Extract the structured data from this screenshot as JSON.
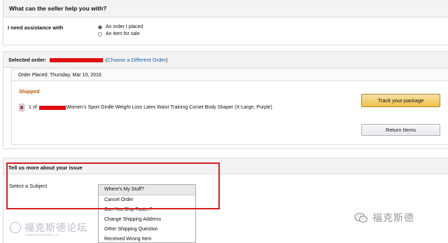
{
  "help_panel": {
    "title": "What can the seller help you with?",
    "assist_label": "I need assistance with",
    "options": [
      {
        "label": "An order I placed",
        "selected": true
      },
      {
        "label": "An item for sale",
        "selected": false
      }
    ]
  },
  "order_panel": {
    "selected_label": "Selected order:",
    "change_link": "Choose a Different Order",
    "placed": "Order Placed: Thursday, Mar 10, 2016",
    "status": "Shipped",
    "item_qty": "1 of",
    "item_title": "Women's Sport Girdle Weight Loss Latex Waist Training Corset Body Shaper (X-Large, Purple)",
    "track_button": "Track your package",
    "return_button": "Return Items"
  },
  "issue_panel": {
    "title": "Tell us more about your issue",
    "subject_label": "Select a Subject",
    "subjects": [
      "Where's My Stuff?",
      "Cancel Order",
      "Can You Ship Faster?",
      "Change Shipping Address",
      "Other Shipping Question",
      "Received Wrong Item"
    ],
    "selected_subject_index": 0
  },
  "watermarks": {
    "left_text": "福克斯德论坛",
    "left_sub": "www.amazonfox.cn",
    "right_text": "福克斯德"
  },
  "colors": {
    "status_orange": "#c45500",
    "link_blue": "#1a5ea8",
    "highlight_red": "#d81e1e",
    "redaction_red": "#e01010",
    "track_button_yellow": "#f0c14b"
  }
}
